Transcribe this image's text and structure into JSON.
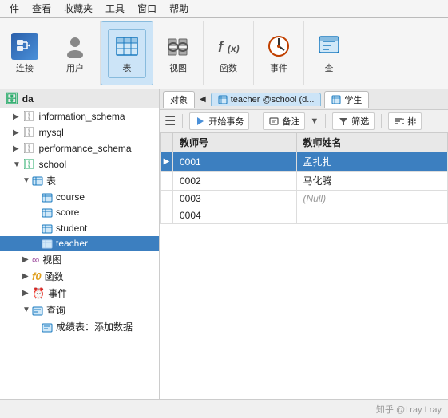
{
  "menubar": {
    "items": [
      "件",
      "查看",
      "收藏夹",
      "工具",
      "窗口",
      "帮助"
    ]
  },
  "toolbar": {
    "connect_label": "连接",
    "user_label": "用户",
    "table_label": "表",
    "view_label": "视图",
    "func_label": "函数",
    "event_label": "事件",
    "query_label": "查"
  },
  "sidebar": {
    "header": "da",
    "items": [
      {
        "label": "information_schema",
        "indent": 1,
        "type": "db",
        "icon": "🗄"
      },
      {
        "label": "mysql",
        "indent": 1,
        "type": "db",
        "icon": "🗄"
      },
      {
        "label": "performance_schema",
        "indent": 1,
        "type": "db",
        "icon": "🗄"
      },
      {
        "label": "school",
        "indent": 1,
        "type": "db",
        "icon": "🗄",
        "expanded": true
      },
      {
        "label": "表",
        "indent": 2,
        "type": "folder",
        "icon": "📋",
        "expanded": true
      },
      {
        "label": "course",
        "indent": 3,
        "type": "table",
        "icon": "📊"
      },
      {
        "label": "score",
        "indent": 3,
        "type": "table",
        "icon": "📊"
      },
      {
        "label": "student",
        "indent": 3,
        "type": "table",
        "icon": "📊"
      },
      {
        "label": "teacher",
        "indent": 3,
        "type": "table",
        "icon": "📊",
        "selected": true
      },
      {
        "label": "视图",
        "indent": 2,
        "type": "folder",
        "icon": "👁"
      },
      {
        "label": "函数",
        "indent": 2,
        "type": "folder",
        "icon": "f"
      },
      {
        "label": "事件",
        "indent": 2,
        "type": "folder",
        "icon": "⏰"
      },
      {
        "label": "查询",
        "indent": 2,
        "type": "folder",
        "icon": "🔍",
        "expanded": true
      },
      {
        "label": "成绩表：添加数据",
        "indent": 3,
        "type": "query",
        "icon": "📄"
      }
    ]
  },
  "content": {
    "tab_objects": "对象",
    "nav_back": "◀",
    "tab_teacher": "teacher @school (d...",
    "tab_student": "学生",
    "toolbar_begin_tx": "开始事务",
    "toolbar_backup": "备注",
    "toolbar_filter": "筛选",
    "toolbar_sort": "排",
    "table": {
      "columns": [
        "教师号",
        "教师姓名"
      ],
      "rows": [
        {
          "id": "0001",
          "name": "孟扎扎",
          "selected": true
        },
        {
          "id": "0002",
          "name": "马化腾",
          "selected": false
        },
        {
          "id": "0003",
          "name": "(Null)",
          "selected": false,
          "null": true
        },
        {
          "id": "0004",
          "name": "",
          "selected": false
        }
      ]
    }
  },
  "bottom_bar": {
    "watermark": "知乎 @Lray Lray"
  }
}
